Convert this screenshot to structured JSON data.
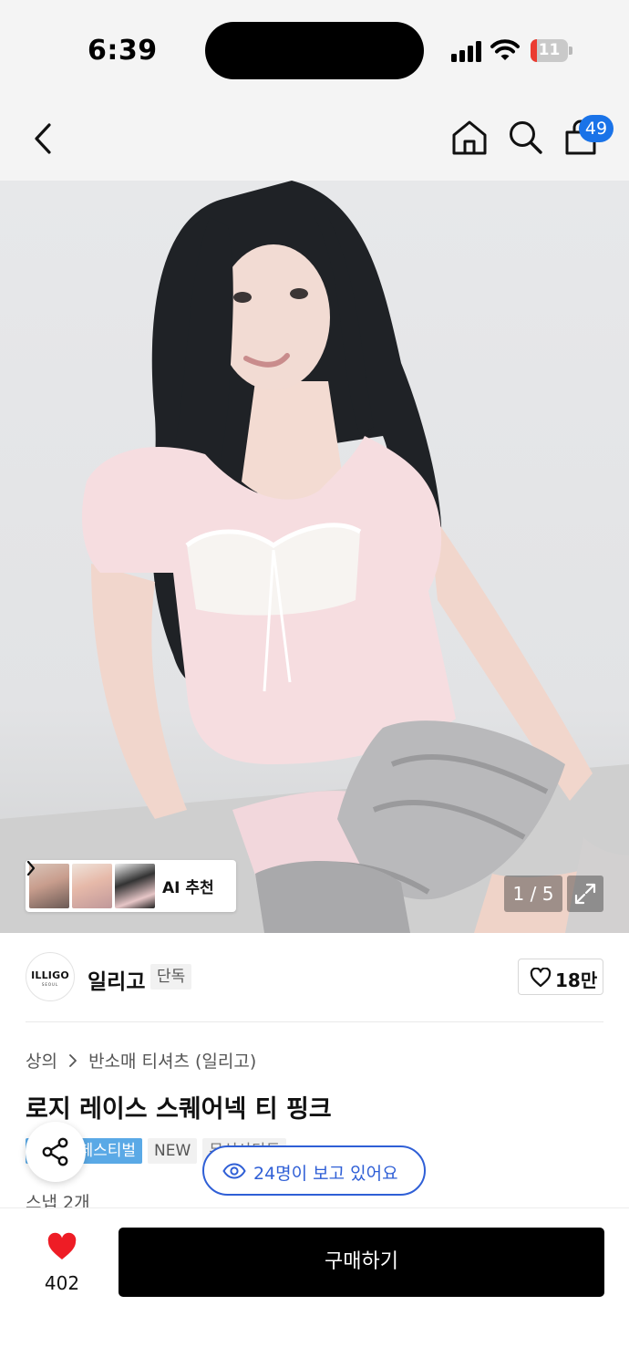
{
  "status_bar": {
    "time": "6:39",
    "battery_level": "11",
    "battery_fraction": 0.11,
    "battery_color": "#eb3b30",
    "signal_icon": "cellular-signal-icon",
    "wifi_icon": "wifi-icon"
  },
  "nav": {
    "back_icon": "chevron-left-icon",
    "home_icon": "home-icon",
    "search_icon": "search-icon",
    "cart_icon": "shopping-bag-icon",
    "cart_count": "49",
    "badge_color": "#1a73e8"
  },
  "gallery": {
    "ai_label": "AI 추천",
    "page_indicator": "1 / 5",
    "expand_icon": "expand-arrows-icon"
  },
  "brand": {
    "logo_text": "ILLIGO",
    "logo_subtext": "SEOUL",
    "name": "일리고",
    "exclusive_tag": "단독",
    "like_count": "18만",
    "heart_icon": "heart-outline-icon"
  },
  "product": {
    "breadcrumb": [
      "상의",
      "반소매 티셔츠 (일리고)"
    ],
    "title": "로지 레이스 스퀘어넥 티 핑크",
    "tags": [
      "페스티벌",
      "NEW",
      "무신사단독"
    ],
    "fest_color": "#5aa9e6",
    "snap_count": "스냅 2개"
  },
  "overlay": {
    "share_icon": "share-icon",
    "viewers_text": "24명이 보고 있어요",
    "eye_icon": "eye-icon",
    "accent_color": "#2f5fd6"
  },
  "bottom_bar": {
    "wish_count": "402",
    "wish_icon": "heart-filled-icon",
    "buy_label": "구매하기"
  }
}
